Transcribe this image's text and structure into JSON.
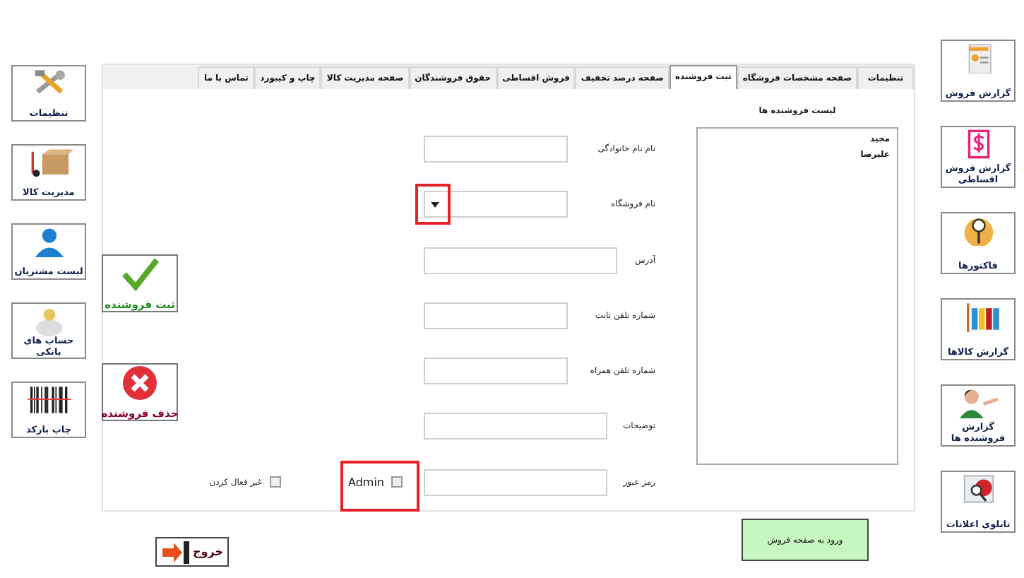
{
  "left_toolbar": [
    {
      "label": "تنظیمات",
      "kind": "tools"
    },
    {
      "label": "مدیریت کالا",
      "kind": "box"
    },
    {
      "label": "لیست مشتریان",
      "kind": "person"
    },
    {
      "label": "حساب های بانکی",
      "kind": "bank"
    },
    {
      "label": "چاپ بارکد",
      "kind": "barcode"
    }
  ],
  "tabs": [
    {
      "label": "تنظیمات",
      "selected": false
    },
    {
      "label": "صفحه مشخصات فروشگاه",
      "selected": false
    },
    {
      "label": "ثبت فروشنده",
      "selected": true
    },
    {
      "label": "صفحه درصد تخفیف",
      "selected": false
    },
    {
      "label": "فروش اقساطی",
      "selected": false
    },
    {
      "label": "حقوق فروشندگان",
      "selected": false
    },
    {
      "label": "صفحه مدیریت کالا",
      "selected": false
    },
    {
      "label": "چاپ و کیبورد",
      "selected": false
    },
    {
      "label": "تماس با ما",
      "selected": false
    }
  ],
  "seller_list": {
    "title": "لیست فروشنده ها",
    "items": [
      "مجید",
      "علیرضا"
    ]
  },
  "form": {
    "fields": [
      {
        "label": "نام نام خانوادگی",
        "kind": "text"
      },
      {
        "label": "نام فروشگاه",
        "kind": "combo"
      },
      {
        "label": "آدرس",
        "kind": "long"
      },
      {
        "label": "شماره تلفن ثابت",
        "kind": "text"
      },
      {
        "label": "شماره تلفن همراه",
        "kind": "text"
      },
      {
        "label": "توضیحات",
        "kind": "long"
      },
      {
        "label": "رمز عبور",
        "kind": "long"
      }
    ],
    "checkboxes": [
      {
        "label": "Admin",
        "checked": false
      },
      {
        "label": "غیر فعال کردن",
        "checked": false
      }
    ],
    "side_buttons": [
      {
        "label": "ثبت فروشنده",
        "kind": "add"
      },
      {
        "label": "حذف فروشنده",
        "kind": "delete"
      }
    ]
  },
  "exit_button": "خروج",
  "sales_page_button": "ورود به صفحه فروش",
  "right_toolbar": [
    {
      "label": "گزارش فروش",
      "kind": "invoice"
    },
    {
      "label": "گزارش فروش اقساطی",
      "kind": "installment"
    },
    {
      "label": "فاکتورها",
      "kind": "search"
    },
    {
      "label": "گزارش کالاها",
      "kind": "chart"
    },
    {
      "label": "گزارش فروشنده ها",
      "kind": "seller"
    },
    {
      "label": "تابلوی اعلانات",
      "kind": "board"
    }
  ]
}
